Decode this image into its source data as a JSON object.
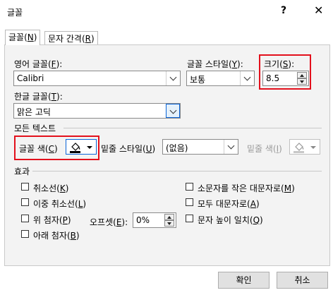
{
  "window": {
    "title": "글꼴",
    "help_glyph": "?",
    "close_glyph": "✕"
  },
  "tabs": [
    {
      "label_prefix": "글꼴(",
      "key": "N",
      "label_suffix": ")"
    },
    {
      "label_prefix": "문자 간격(",
      "key": "R",
      "label_suffix": ")"
    }
  ],
  "latin_font": {
    "label_prefix": "영어 글꼴(",
    "key": "F",
    "label_suffix": "):",
    "value": "Calibri"
  },
  "font_style": {
    "label_prefix": "글꼴 스타일(",
    "key": "Y",
    "label_suffix": "):",
    "value": "보통"
  },
  "size": {
    "label_prefix": "크기(",
    "key": "S",
    "label_suffix": "):",
    "value": "8.5"
  },
  "asian_font": {
    "label_prefix": "한글 글꼴(",
    "key": "T",
    "label_suffix": "):",
    "value": "맑은 고딕"
  },
  "all_text": {
    "section_title": "모든 텍스트",
    "font_color": {
      "label_prefix": "글꼴 색(",
      "key": "C",
      "label_suffix": ")",
      "swatch_color": "#000000"
    },
    "underline_style": {
      "label_prefix": "밑줄 스타일(",
      "key": "U",
      "label_suffix": ")",
      "value": "(없음)"
    },
    "underline_color": {
      "label_prefix": "밑줄 색(",
      "key": "I",
      "label_suffix": ")"
    }
  },
  "effects": {
    "section_title": "효과",
    "left": [
      {
        "label_prefix": "취소선(",
        "key": "K",
        "label_suffix": ")"
      },
      {
        "label_prefix": "이중 취소선(",
        "key": "L",
        "label_suffix": ")"
      },
      {
        "label_prefix": "위 첨자(",
        "key": "P",
        "label_suffix": ")"
      },
      {
        "label_prefix": "아래 첨자(",
        "key": "B",
        "label_suffix": ")"
      }
    ],
    "right": [
      {
        "label_prefix": "소문자를 작은 대문자로(",
        "key": "M",
        "label_suffix": ")"
      },
      {
        "label_prefix": "모두 대문자로(",
        "key": "A",
        "label_suffix": ")"
      },
      {
        "label_prefix": "문자 높이 일치(",
        "key": "Q",
        "label_suffix": ")"
      }
    ],
    "offset": {
      "label_prefix": "오프셋(",
      "key": "E",
      "label_suffix": "):",
      "value": "0%"
    }
  },
  "buttons": {
    "ok": "확인",
    "cancel": "취소"
  },
  "colors": {
    "highlight_red": "#e3101c",
    "focus_blue": "#0a64d8",
    "panel_bg": "#f3f3f3"
  }
}
